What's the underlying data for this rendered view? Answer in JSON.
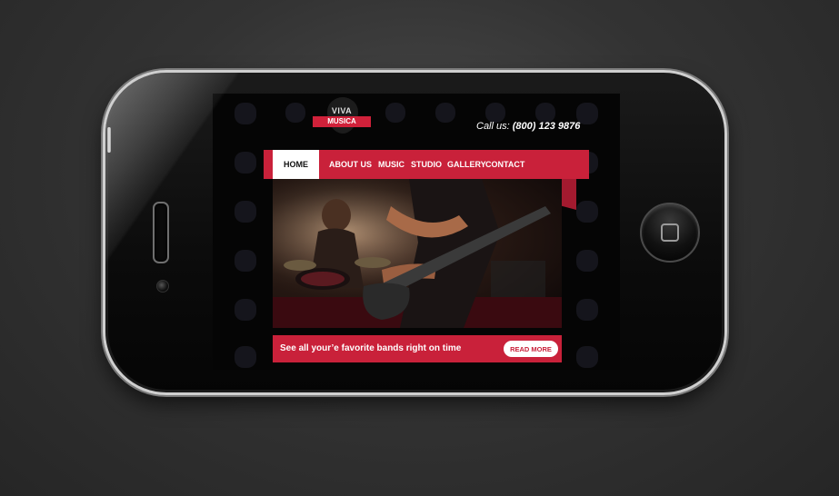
{
  "site": {
    "logo_top": "VIVA",
    "logo_band": "MUSICA",
    "call_prefix": "Call us:",
    "call_number": "(800) 123 9876"
  },
  "nav": {
    "items": [
      {
        "label": "HOME",
        "active": true
      },
      {
        "label": "ABOUT US"
      },
      {
        "label": "MUSIC"
      },
      {
        "label": "STUDIO"
      },
      {
        "label": "GALLERY"
      },
      {
        "label": "CONTACT"
      }
    ]
  },
  "cta": {
    "text": "See all your’e favorite bands right on time",
    "button": "READ MORE"
  },
  "colors": {
    "accent": "#c9213a",
    "background": "#050505"
  },
  "icons": {
    "home_button": "home-square-icon",
    "logo_shape": "guitar-pick-icon"
  }
}
